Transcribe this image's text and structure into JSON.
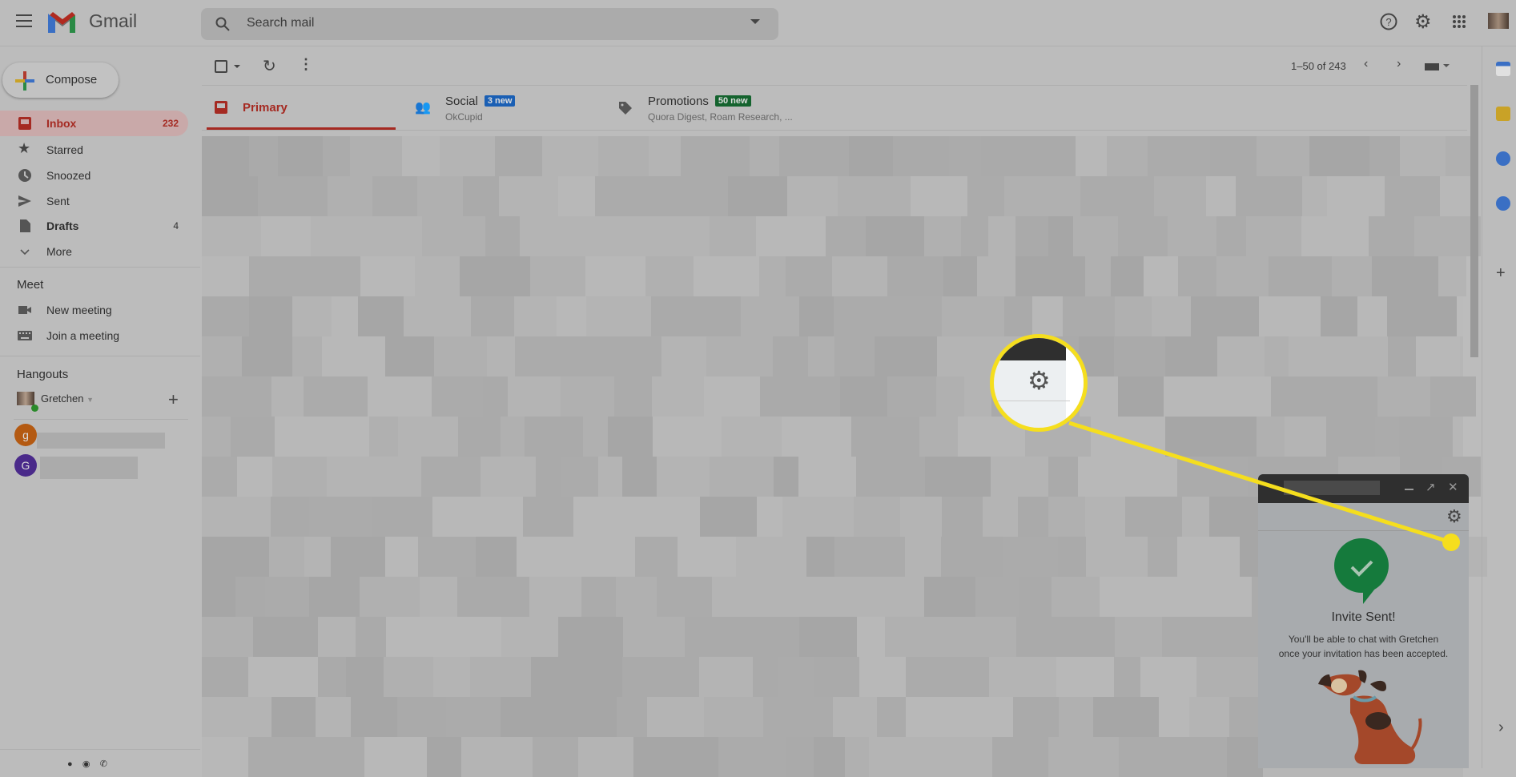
{
  "header": {
    "app_name": "Gmail",
    "search_placeholder": "Search mail"
  },
  "compose_label": "Compose",
  "sidebar": {
    "items": [
      {
        "label": "Inbox",
        "count": "232",
        "icon": "inbox-icon"
      },
      {
        "label": "Starred",
        "count": "",
        "icon": "star-icon"
      },
      {
        "label": "Snoozed",
        "count": "",
        "icon": "clock-icon"
      },
      {
        "label": "Sent",
        "count": "",
        "icon": "send-icon"
      },
      {
        "label": "Drafts",
        "count": "4",
        "icon": "draft-icon"
      },
      {
        "label": "More",
        "count": "",
        "icon": "chevron-down-icon"
      }
    ],
    "meet": {
      "title": "Meet",
      "items": [
        {
          "label": "New meeting"
        },
        {
          "label": "Join a meeting"
        }
      ]
    },
    "hangouts": {
      "title": "Hangouts",
      "user": "Gretchen",
      "contacts": [
        {
          "initial": "g",
          "color": "#b45a12"
        },
        {
          "initial": "G",
          "color": "#4a2a8a"
        }
      ]
    }
  },
  "toolbar": {
    "pagination": "1–50 of 243"
  },
  "tabs": [
    {
      "label": "Primary",
      "badge": "",
      "subtitle": ""
    },
    {
      "label": "Social",
      "badge": "3 new",
      "subtitle": "OkCupid",
      "badge_color": "#1a5fb4"
    },
    {
      "label": "Promotions",
      "badge": "50 new",
      "subtitle": "Quora Digest, Roam Research, ...",
      "badge_color": "#14632e"
    }
  ],
  "chat": {
    "title": "Invite Sent!",
    "message_line1": "You'll be able to chat with Gretchen",
    "message_line2": "once your invitation has been accepted."
  },
  "colors": {
    "accent": "#b3261e",
    "highlight": "#f5de1e",
    "check_green": "#157a3c"
  }
}
